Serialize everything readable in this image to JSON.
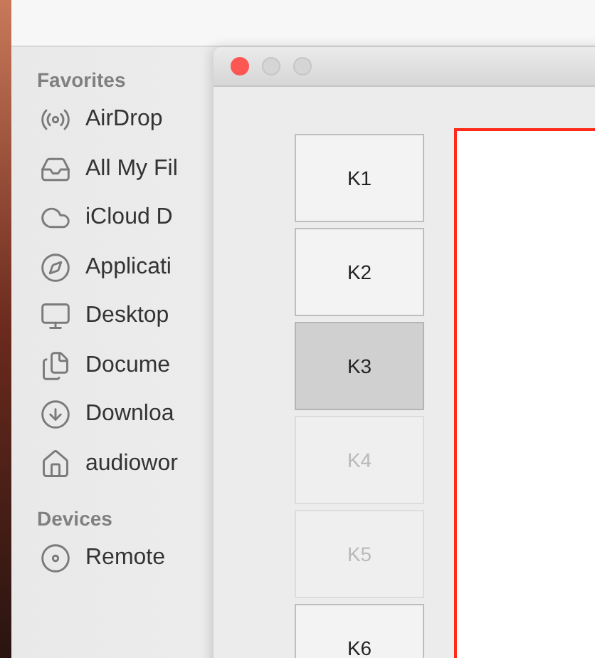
{
  "sidebar": {
    "sections": [
      {
        "title": "Favorites",
        "items": [
          {
            "kind": "airdrop",
            "label": "AirDrop"
          },
          {
            "kind": "files",
            "label": "All My Fil"
          },
          {
            "kind": "cloud",
            "label": "iCloud D"
          },
          {
            "kind": "apps",
            "label": "Applicati"
          },
          {
            "kind": "desktop",
            "label": "Desktop"
          },
          {
            "kind": "documents",
            "label": "Docume"
          },
          {
            "kind": "downloads",
            "label": "Downloa"
          },
          {
            "kind": "home",
            "label": "audiowor"
          }
        ]
      },
      {
        "title": "Devices",
        "items": [
          {
            "kind": "disc",
            "label": "Remote"
          }
        ]
      }
    ]
  },
  "window": {
    "keys": [
      {
        "label": "K1",
        "selected": false,
        "disabled": false
      },
      {
        "label": "K2",
        "selected": false,
        "disabled": false
      },
      {
        "label": "K3",
        "selected": true,
        "disabled": false
      },
      {
        "label": "K4",
        "selected": false,
        "disabled": true
      },
      {
        "label": "K5",
        "selected": false,
        "disabled": true
      },
      {
        "label": "K6",
        "selected": false,
        "disabled": false
      }
    ]
  }
}
